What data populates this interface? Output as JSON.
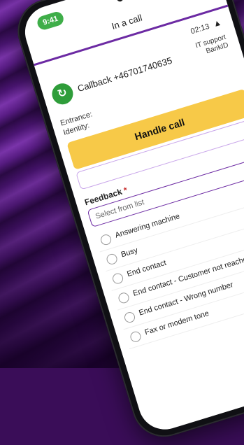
{
  "status": {
    "time": "9:41"
  },
  "screen": {
    "title": "In a call"
  },
  "call": {
    "elapsed": "02:13",
    "label": "Callback +46701740635",
    "side_info": [
      "IT support",
      "BankID"
    ],
    "entrance_label": "Entrance:",
    "identity_label": "Identity:",
    "handle_button": "Handle call"
  },
  "feedback": {
    "label": "Feedback",
    "required_mark": "*",
    "placeholder": "Select from list",
    "options": [
      "Answering machine",
      "Busy",
      "End contact",
      "End contact - Customer not reached",
      "End contact - Wrong number",
      "Fax or modem tone"
    ]
  },
  "colors": {
    "accent": "#6c2aa3",
    "brand_yellow": "#f7c948",
    "call_green": "#2f9d3a"
  }
}
